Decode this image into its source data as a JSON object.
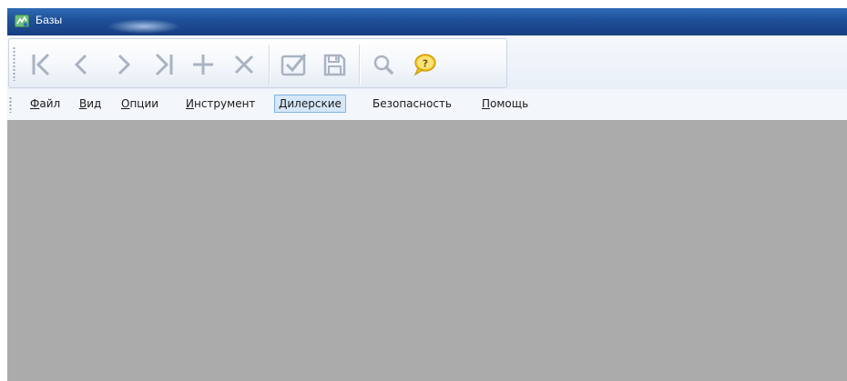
{
  "window": {
    "title": "Базы",
    "app_icon": "database-app-icon"
  },
  "toolbar": {
    "buttons": [
      {
        "name": "first-record",
        "icon": "first-record-icon",
        "enabled": false
      },
      {
        "name": "prev-record",
        "icon": "chevron-left-icon",
        "enabled": false
      },
      {
        "name": "next-record",
        "icon": "chevron-right-icon",
        "enabled": false
      },
      {
        "name": "last-record",
        "icon": "last-record-icon",
        "enabled": false
      },
      {
        "name": "add-record",
        "icon": "plus-icon",
        "enabled": false
      },
      {
        "name": "delete-record",
        "icon": "close-icon",
        "enabled": false
      },
      {
        "name": "apply",
        "icon": "checkbox-icon",
        "enabled": false
      },
      {
        "name": "save",
        "icon": "floppy-disk-icon",
        "enabled": false
      },
      {
        "name": "search",
        "icon": "magnifier-icon",
        "enabled": false
      },
      {
        "name": "help",
        "icon": "help-bubble-icon",
        "enabled": true
      }
    ],
    "disabled_color": "#a9b3c2",
    "help_color": "#f3c21a"
  },
  "menu": {
    "items": [
      {
        "label": "Файл",
        "key": "Ф",
        "rest": "айл"
      },
      {
        "label": "Вид",
        "key": "В",
        "rest": "ид"
      },
      {
        "label": "Опции",
        "key": "О",
        "rest": "пции"
      },
      {
        "label": "Инструмент",
        "key": "И",
        "rest": "нструмент"
      },
      {
        "label": "Дилерские",
        "key": "",
        "rest": "Дилерские",
        "active": true
      },
      {
        "label": "Безопасность",
        "key": "",
        "rest": "Безопасность"
      },
      {
        "label": "Помощь",
        "key": "П",
        "rest": "омощь"
      }
    ]
  },
  "colors": {
    "titlebar": "#1e4f98",
    "workspace": "#ababab",
    "menu_highlight": "#d5e7f8",
    "menu_highlight_border": "#7fb3e3"
  }
}
